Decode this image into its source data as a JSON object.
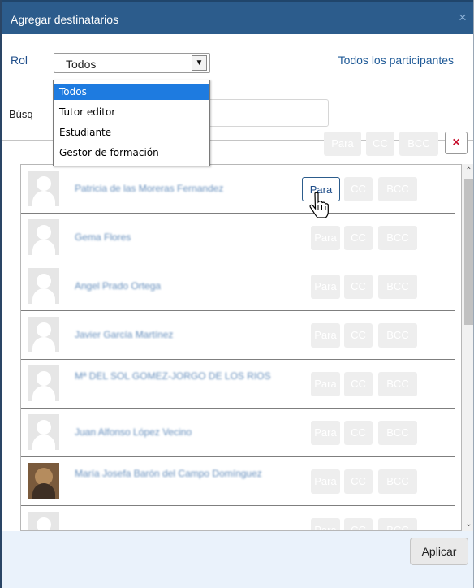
{
  "dialog": {
    "title": "Agregar destinatarios",
    "close_glyph": "×"
  },
  "filters": {
    "rol_label": "Rol",
    "rol_value": "Todos",
    "rol_options": [
      "Todos",
      "Tutor editor",
      "Estudiante",
      "Gestor de formación"
    ],
    "all_participants_link": "Todos los participantes",
    "search_label": "Búsq",
    "search_value": ""
  },
  "header_buttons": {
    "para": "Para",
    "cc": "CC",
    "bcc": "BCC",
    "clear": "×"
  },
  "participants": [
    {
      "name": "Patricia de las Moreras Fernandez",
      "avatar": "user-placeholder-icon",
      "active": "Para"
    },
    {
      "name": "Gema Flores",
      "avatar": "user-placeholder-icon"
    },
    {
      "name": "Angel Prado Ortega",
      "avatar": "user-placeholder-icon"
    },
    {
      "name": "Javier García Martínez",
      "avatar": "user-placeholder-icon"
    },
    {
      "name": "Mª DEL SOL GOMEZ-JORGO DE LOS RIOS",
      "avatar": "user-placeholder-icon"
    },
    {
      "name": "Juan Alfonso López Vecino",
      "avatar": "user-placeholder-icon"
    },
    {
      "name": "María Josefa Barón del Campo Domínguez",
      "avatar": "user-photo"
    },
    {
      "name": "",
      "avatar": "user-placeholder-icon"
    }
  ],
  "row_buttons": {
    "para": "Para",
    "cc": "CC",
    "bcc": "BCC"
  },
  "footer": {
    "apply_label": "Aplicar"
  },
  "colors": {
    "titlebar": "#2c5c8c",
    "link": "#1f5a97",
    "dropdown_selected": "#1e7be0",
    "footer_bg": "#eaf2fb",
    "clear_x": "#c8102e"
  }
}
